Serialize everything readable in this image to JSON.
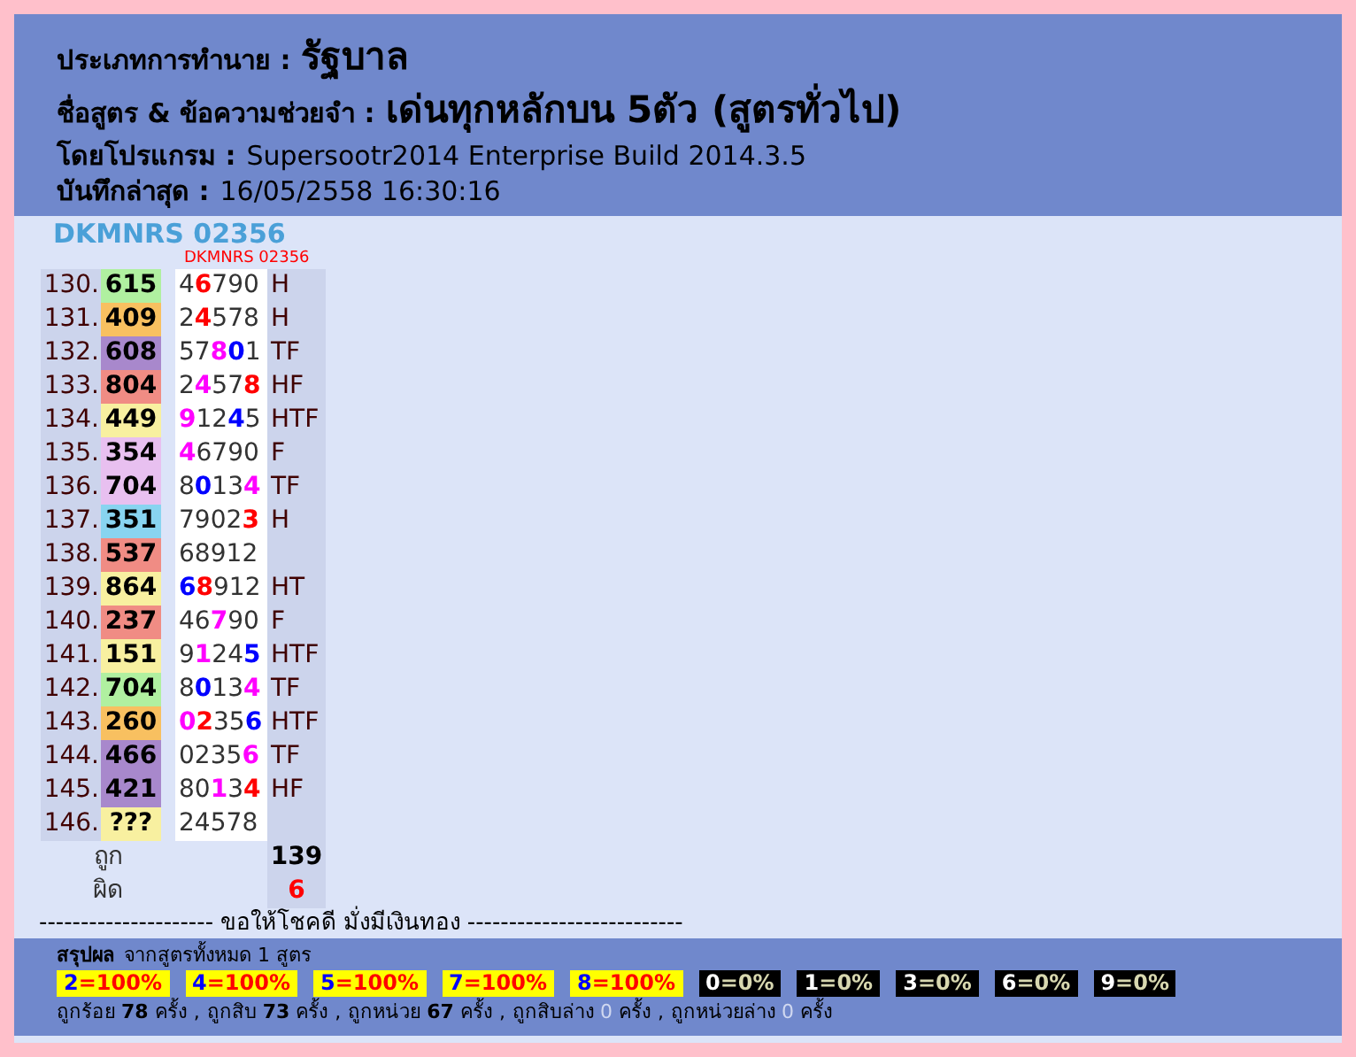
{
  "header": {
    "type_label": "ประเภทการทำนาย :",
    "type_value": "รัฐบาล",
    "formula_label": "ชื่อสูตร & ข้อความช่วยจำ :",
    "formula_value": "เด่นทุกหลักบน 5ตัว (สูตรทั่วไป)",
    "program_label": "โดยโปรแกรม :",
    "program_value": "Supersootr2014 Enterprise Build 2014.3.5",
    "saved_label": "บันทึกล่าสุด :",
    "saved_value": "16/05/2558 16:30:16"
  },
  "code_title": "DKMNRS 02356",
  "table": {
    "column_caption": "DKMNRS 02356",
    "rows": [
      {
        "index": "130.",
        "number": "615",
        "color": "#b0f0a0",
        "digits": [
          {
            "text": "4"
          },
          {
            "text": "6",
            "color": "#ff0000"
          },
          {
            "text": "7"
          },
          {
            "text": "9"
          },
          {
            "text": "0"
          }
        ],
        "hits": "H"
      },
      {
        "index": "131.",
        "number": "409",
        "color": "#f8c060",
        "digits": [
          {
            "text": "2"
          },
          {
            "text": "4",
            "color": "#ff0000"
          },
          {
            "text": "5"
          },
          {
            "text": "7"
          },
          {
            "text": "8"
          }
        ],
        "hits": "H"
      },
      {
        "index": "132.",
        "number": "608",
        "color": "#a888cc",
        "digits": [
          {
            "text": "5"
          },
          {
            "text": "7"
          },
          {
            "text": "8",
            "color": "#ff00ff"
          },
          {
            "text": "0",
            "color": "#0000ff"
          },
          {
            "text": "1"
          }
        ],
        "hits": "TF"
      },
      {
        "index": "133.",
        "number": "804",
        "color": "#f08c84",
        "digits": [
          {
            "text": "2"
          },
          {
            "text": "4",
            "color": "#ff00ff"
          },
          {
            "text": "5"
          },
          {
            "text": "7"
          },
          {
            "text": "8",
            "color": "#ff0000"
          }
        ],
        "hits": "HF"
      },
      {
        "index": "134.",
        "number": "449",
        "color": "#f8f0a0",
        "digits": [
          {
            "text": "9",
            "color": "#ff00ff"
          },
          {
            "text": "1"
          },
          {
            "text": "2"
          },
          {
            "text": "4",
            "color": "#0000ff"
          },
          {
            "text": "5"
          }
        ],
        "hits": "HTF"
      },
      {
        "index": "135.",
        "number": "354",
        "color": "#e8c0f0",
        "digits": [
          {
            "text": "4",
            "color": "#ff00ff"
          },
          {
            "text": "6"
          },
          {
            "text": "7"
          },
          {
            "text": "9"
          },
          {
            "text": "0"
          }
        ],
        "hits": "F"
      },
      {
        "index": "136.",
        "number": "704",
        "color": "#e8c0f0",
        "digits": [
          {
            "text": "8"
          },
          {
            "text": "0",
            "color": "#0000ff"
          },
          {
            "text": "1"
          },
          {
            "text": "3"
          },
          {
            "text": "4",
            "color": "#ff00ff"
          }
        ],
        "hits": "TF"
      },
      {
        "index": "137.",
        "number": "351",
        "color": "#88d4f0",
        "digits": [
          {
            "text": "7"
          },
          {
            "text": "9"
          },
          {
            "text": "0"
          },
          {
            "text": "2"
          },
          {
            "text": "3",
            "color": "#ff0000"
          }
        ],
        "hits": "H"
      },
      {
        "index": "138.",
        "number": "537",
        "color": "#f08c84",
        "digits": [
          {
            "text": "6"
          },
          {
            "text": "8"
          },
          {
            "text": "9"
          },
          {
            "text": "1"
          },
          {
            "text": "2"
          }
        ]
      },
      {
        "index": "139.",
        "number": "864",
        "color": "#f8f0a0",
        "digits": [
          {
            "text": "6",
            "color": "#0000ff"
          },
          {
            "text": "8",
            "color": "#ff0000"
          },
          {
            "text": "9"
          },
          {
            "text": "1"
          },
          {
            "text": "2"
          }
        ],
        "hits": "HT"
      },
      {
        "index": "140.",
        "number": "237",
        "color": "#f08c84",
        "digits": [
          {
            "text": "4"
          },
          {
            "text": "6"
          },
          {
            "text": "7",
            "color": "#ff00ff"
          },
          {
            "text": "9"
          },
          {
            "text": "0"
          }
        ],
        "hits": "F"
      },
      {
        "index": "141.",
        "number": "151",
        "color": "#f8f0a0",
        "digits": [
          {
            "text": "9"
          },
          {
            "text": "1",
            "color": "#ff00ff"
          },
          {
            "text": "2"
          },
          {
            "text": "4"
          },
          {
            "text": "5",
            "color": "#0000ff"
          }
        ],
        "hits": "HTF"
      },
      {
        "index": "142.",
        "number": "704",
        "color": "#b0f0a0",
        "digits": [
          {
            "text": "8"
          },
          {
            "text": "0",
            "color": "#0000ff"
          },
          {
            "text": "1"
          },
          {
            "text": "3"
          },
          {
            "text": "4",
            "color": "#ff00ff"
          }
        ],
        "hits": "TF"
      },
      {
        "index": "143.",
        "number": "260",
        "color": "#f8c060",
        "digits": [
          {
            "text": "0",
            "color": "#ff00ff"
          },
          {
            "text": "2",
            "color": "#ff0000"
          },
          {
            "text": "3"
          },
          {
            "text": "5"
          },
          {
            "text": "6",
            "color": "#0000ff"
          }
        ],
        "hits": "HTF"
      },
      {
        "index": "144.",
        "number": "466",
        "color": "#a888cc",
        "digits": [
          {
            "text": "0"
          },
          {
            "text": "2"
          },
          {
            "text": "3"
          },
          {
            "text": "5"
          },
          {
            "text": "6",
            "color": "#ff00ff"
          }
        ],
        "hits": "TF"
      },
      {
        "index": "145.",
        "number": "421",
        "color": "#a888cc",
        "digits": [
          {
            "text": "8"
          },
          {
            "text": "0"
          },
          {
            "text": "1",
            "color": "#ff00ff"
          },
          {
            "text": "3"
          },
          {
            "text": "4",
            "color": "#ff0000"
          }
        ],
        "hits": "HF"
      },
      {
        "index": "146.",
        "number": "???",
        "color": "#f8f0a0",
        "digits": [
          {
            "text": "2"
          },
          {
            "text": "4"
          },
          {
            "text": "5"
          },
          {
            "text": "7"
          },
          {
            "text": "8"
          }
        ]
      }
    ],
    "totals": [
      {
        "label": "ถูก",
        "value": "139",
        "kind": "right"
      },
      {
        "label": "ผิด",
        "value": "6",
        "kind": "wrong"
      }
    ]
  },
  "divider_text": "--------------------- ขอให้โชคดี มั่งมีเงินทอง --------------------------",
  "summary": {
    "title": "สรุปผล",
    "subtitle": "จากสูตรทั้งหมด 1 สูตร",
    "badges": [
      {
        "digit": "2",
        "percent": "=100%",
        "kind": "hit"
      },
      {
        "digit": "4",
        "percent": "=100%",
        "kind": "hit"
      },
      {
        "digit": "5",
        "percent": "=100%",
        "kind": "hit"
      },
      {
        "digit": "7",
        "percent": "=100%",
        "kind": "hit"
      },
      {
        "digit": "8",
        "percent": "=100%",
        "kind": "hit"
      },
      {
        "digit": "0",
        "percent": "=0%",
        "kind": "miss"
      },
      {
        "digit": "1",
        "percent": "=0%",
        "kind": "miss"
      },
      {
        "digit": "3",
        "percent": "=0%",
        "kind": "miss"
      },
      {
        "digit": "6",
        "percent": "=0%",
        "kind": "miss"
      },
      {
        "digit": "9",
        "percent": "=0%",
        "kind": "miss"
      }
    ],
    "stats": [
      {
        "label": "ถูกร้อย",
        "count": "78",
        "unit": "ครั้ง",
        "zero": false
      },
      {
        "label": "ถูกสิบ",
        "count": "73",
        "unit": "ครั้ง",
        "zero": false
      },
      {
        "label": "ถูกหน่วย",
        "count": "67",
        "unit": "ครั้ง",
        "zero": false
      },
      {
        "label": "ถูกสิบล่าง",
        "count": "0",
        "unit": "ครั้ง",
        "zero": true
      },
      {
        "label": "ถูกหน่วยล่าง",
        "count": "0",
        "unit": "ครั้ง",
        "zero": true
      }
    ],
    "separator": ","
  }
}
